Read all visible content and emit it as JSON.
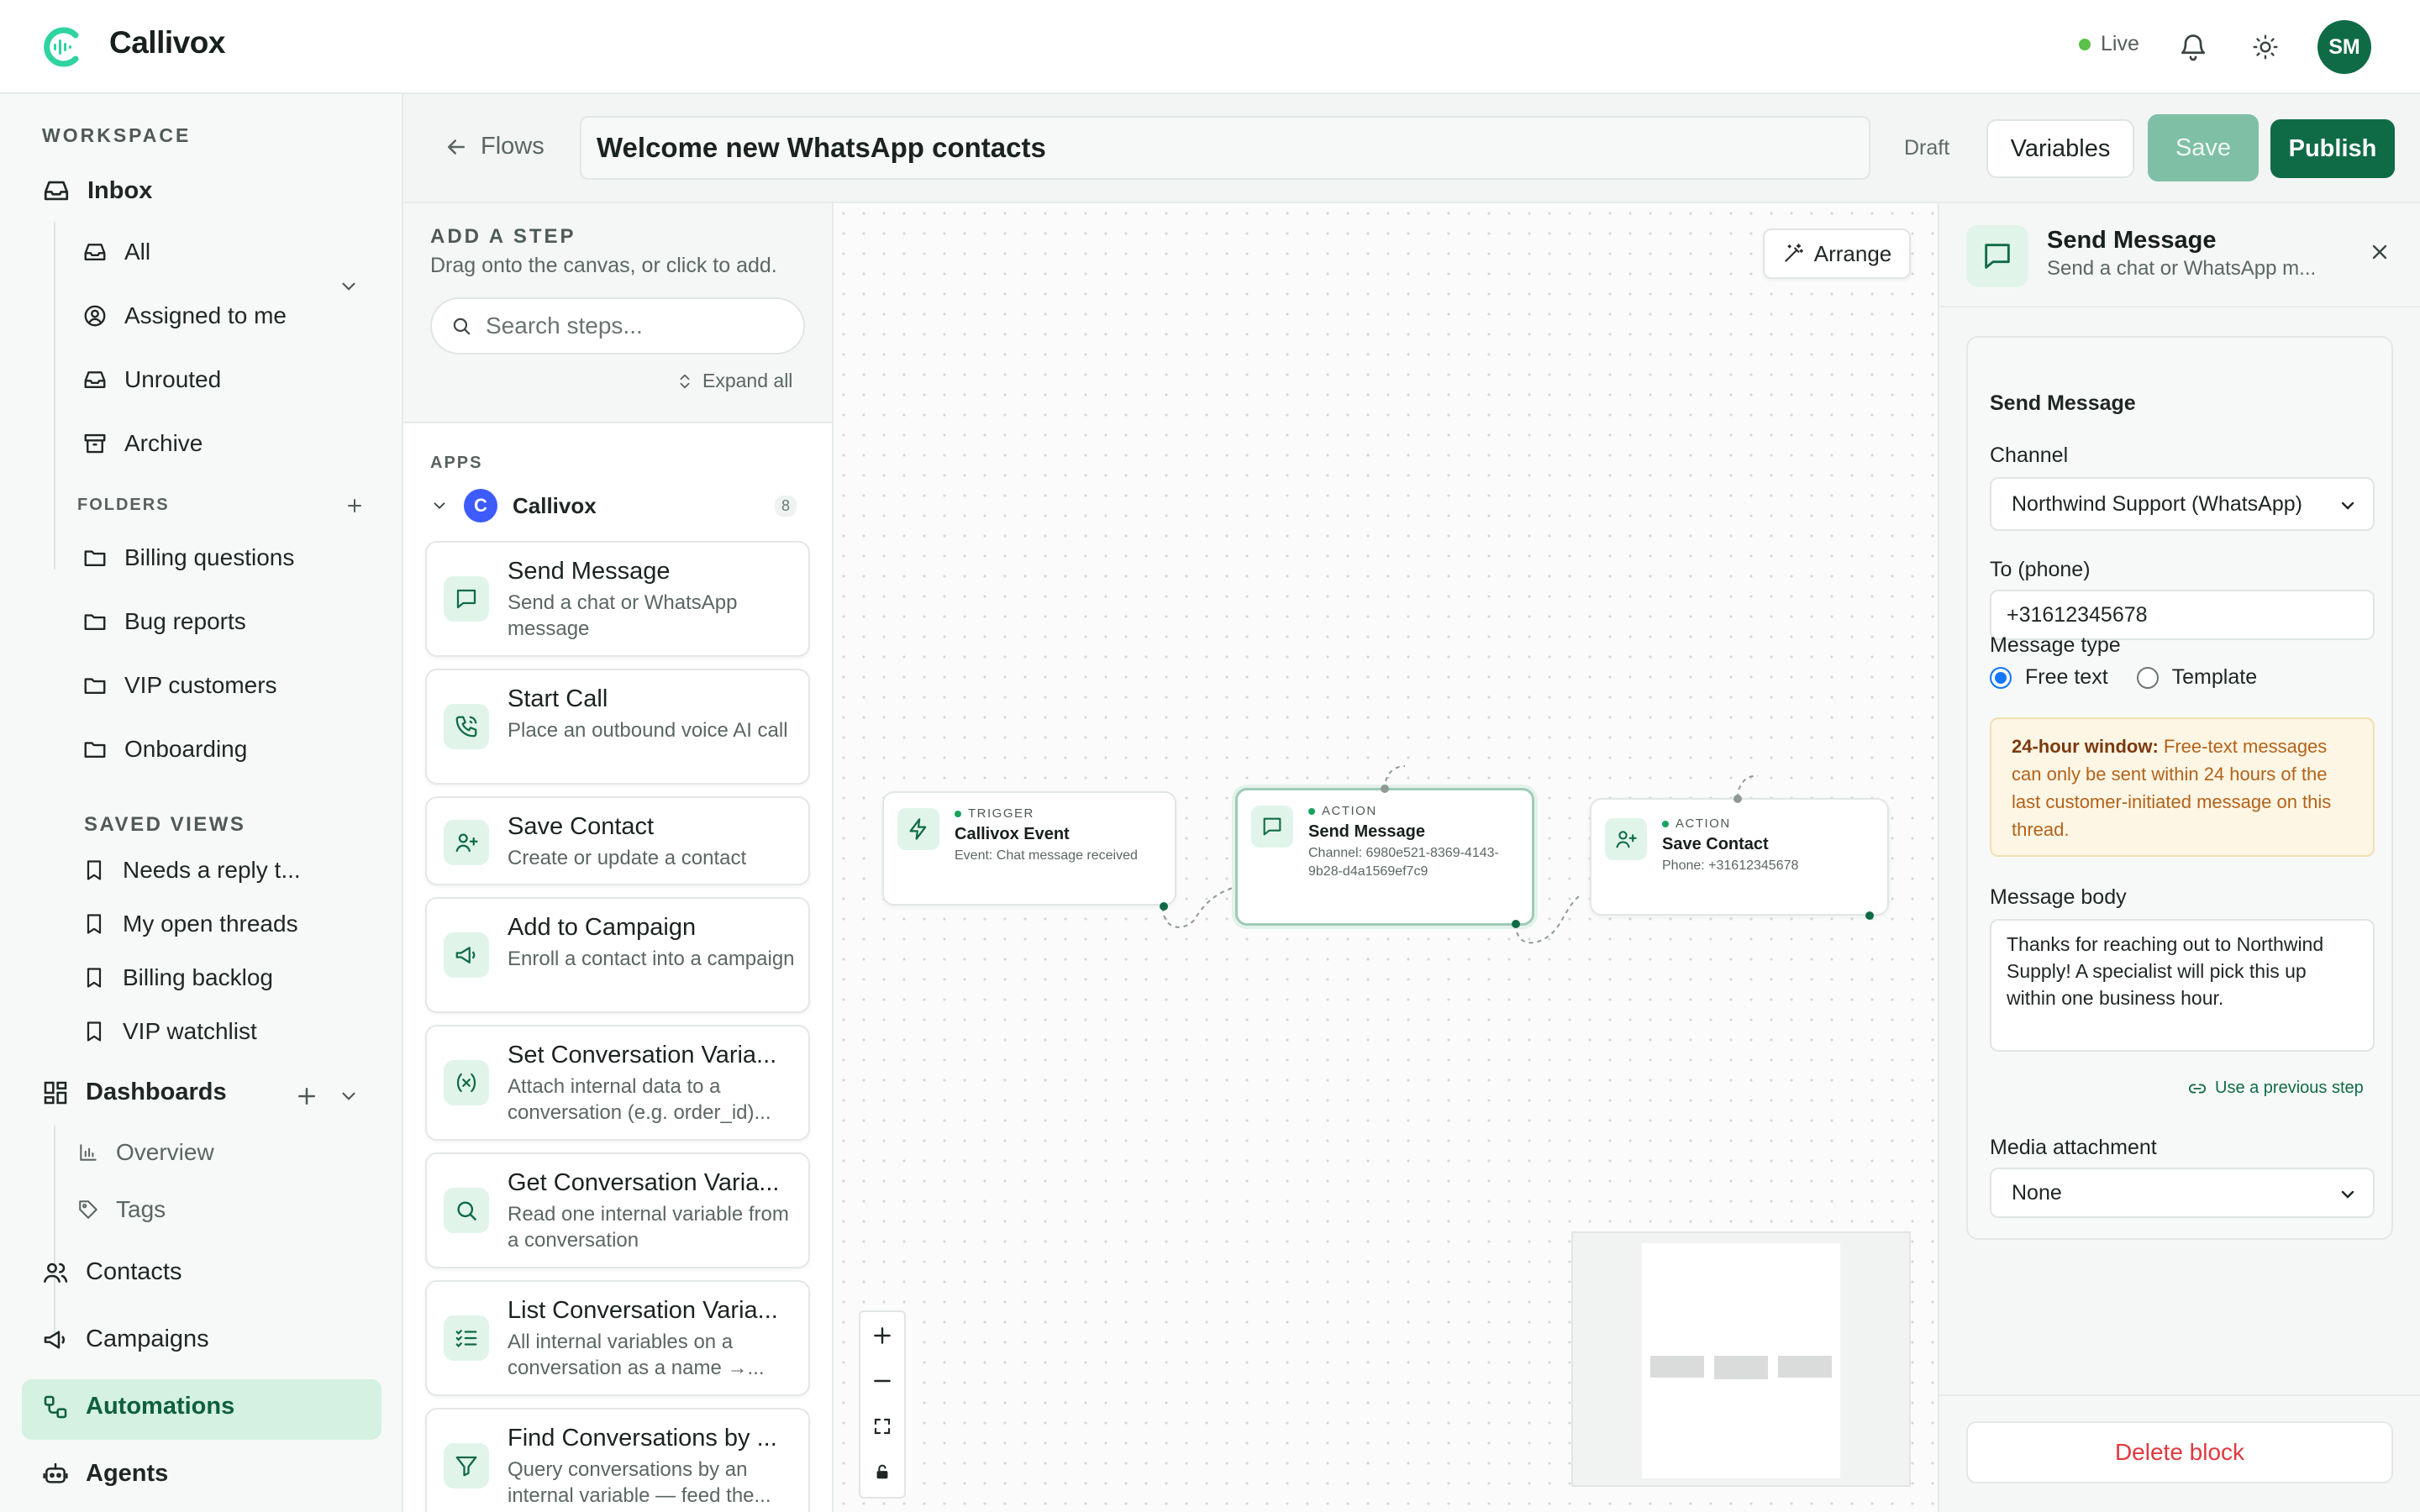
{
  "app": {
    "brand": "Callivox",
    "status": "Live",
    "user_initials": "SM",
    "accent": "#0f6b46"
  },
  "sidebar": {
    "workspace_label": "WORKSPACE",
    "inbox": {
      "label": "Inbox",
      "items": [
        "All",
        "Assigned to me",
        "Unrouted",
        "Archive"
      ]
    },
    "folders": {
      "label": "FOLDERS",
      "items": [
        "Billing questions",
        "Bug reports",
        "VIP customers",
        "Onboarding"
      ]
    },
    "saved_views": {
      "label": "SAVED VIEWS",
      "items": [
        "Needs a reply t...",
        "My open threads",
        "Billing backlog",
        "VIP watchlist"
      ]
    },
    "dashboards": {
      "label": "Dashboards",
      "items": [
        "Overview",
        "Tags"
      ]
    },
    "nav": [
      "Contacts",
      "Campaigns",
      "Automations",
      "Agents"
    ],
    "active": "Automations"
  },
  "flow": {
    "back_label": "Flows",
    "title": "Welcome new WhatsApp contacts",
    "status": "Draft",
    "variables_label": "Variables",
    "save_label": "Save",
    "publish_label": "Publish"
  },
  "steps_panel": {
    "heading": "ADD A STEP",
    "hint": "Drag onto the canvas, or click to add.",
    "search_placeholder": "Search steps...",
    "expand_label": "Expand all",
    "apps_label": "APPS",
    "app": {
      "initial": "C",
      "name": "Callivox",
      "count": "8"
    },
    "steps": [
      {
        "title": "Send Message",
        "desc": "Send a chat or WhatsApp message",
        "icon": "message-icon"
      },
      {
        "title": "Start Call",
        "desc": "Place an outbound voice AI call",
        "icon": "phone-icon"
      },
      {
        "title": "Save Contact",
        "desc": "Create or update a contact",
        "icon": "user-plus-icon"
      },
      {
        "title": "Add to Campaign",
        "desc": "Enroll a contact into a campaign",
        "icon": "megaphone-icon"
      },
      {
        "title": "Set Conversation Varia...",
        "desc": "Attach internal data to a conversation (e.g. order_id)...",
        "icon": "variable-icon"
      },
      {
        "title": "Get Conversation Varia...",
        "desc": "Read one internal variable from a conversation",
        "icon": "search-icon"
      },
      {
        "title": "List Conversation Varia...",
        "desc": "All internal variables on a conversation as a name →...",
        "icon": "list-check-icon"
      },
      {
        "title": "Find Conversations by ...",
        "desc": "Query conversations by an internal variable — feed the...",
        "icon": "filter-icon"
      }
    ]
  },
  "canvas": {
    "arrange_label": "Arrange",
    "nodes": [
      {
        "kind": "TRIGGER",
        "title": "Callivox Event",
        "desc": "Event: Chat message received"
      },
      {
        "kind": "ACTION",
        "title": "Send Message",
        "desc": "Channel: 6980e521-8369-4143-9b28-d4a1569ef7c9"
      },
      {
        "kind": "ACTION",
        "title": "Save Contact",
        "desc": "Phone: +31612345678"
      }
    ]
  },
  "inspector": {
    "title": "Send Message",
    "subtitle": "Send a chat or WhatsApp m...",
    "section": "Send Message",
    "channel_label": "Channel",
    "channel_value": "Northwind Support (WhatsApp)",
    "to_label": "To (phone)",
    "to_value": "+31612345678",
    "type_label": "Message type",
    "type_options": [
      "Free text",
      "Template"
    ],
    "notice_strong": "24-hour window:",
    "notice_text": "Free-text messages can only be sent within 24 hours of the last customer-initiated message on this thread.",
    "body_label": "Message body",
    "body_value": "Thanks for reaching out to Northwind Supply! A specialist will pick this up within one business hour.",
    "prev_step_label": "Use a previous step",
    "media_label": "Media attachment",
    "media_value": "None",
    "delete_label": "Delete block"
  }
}
